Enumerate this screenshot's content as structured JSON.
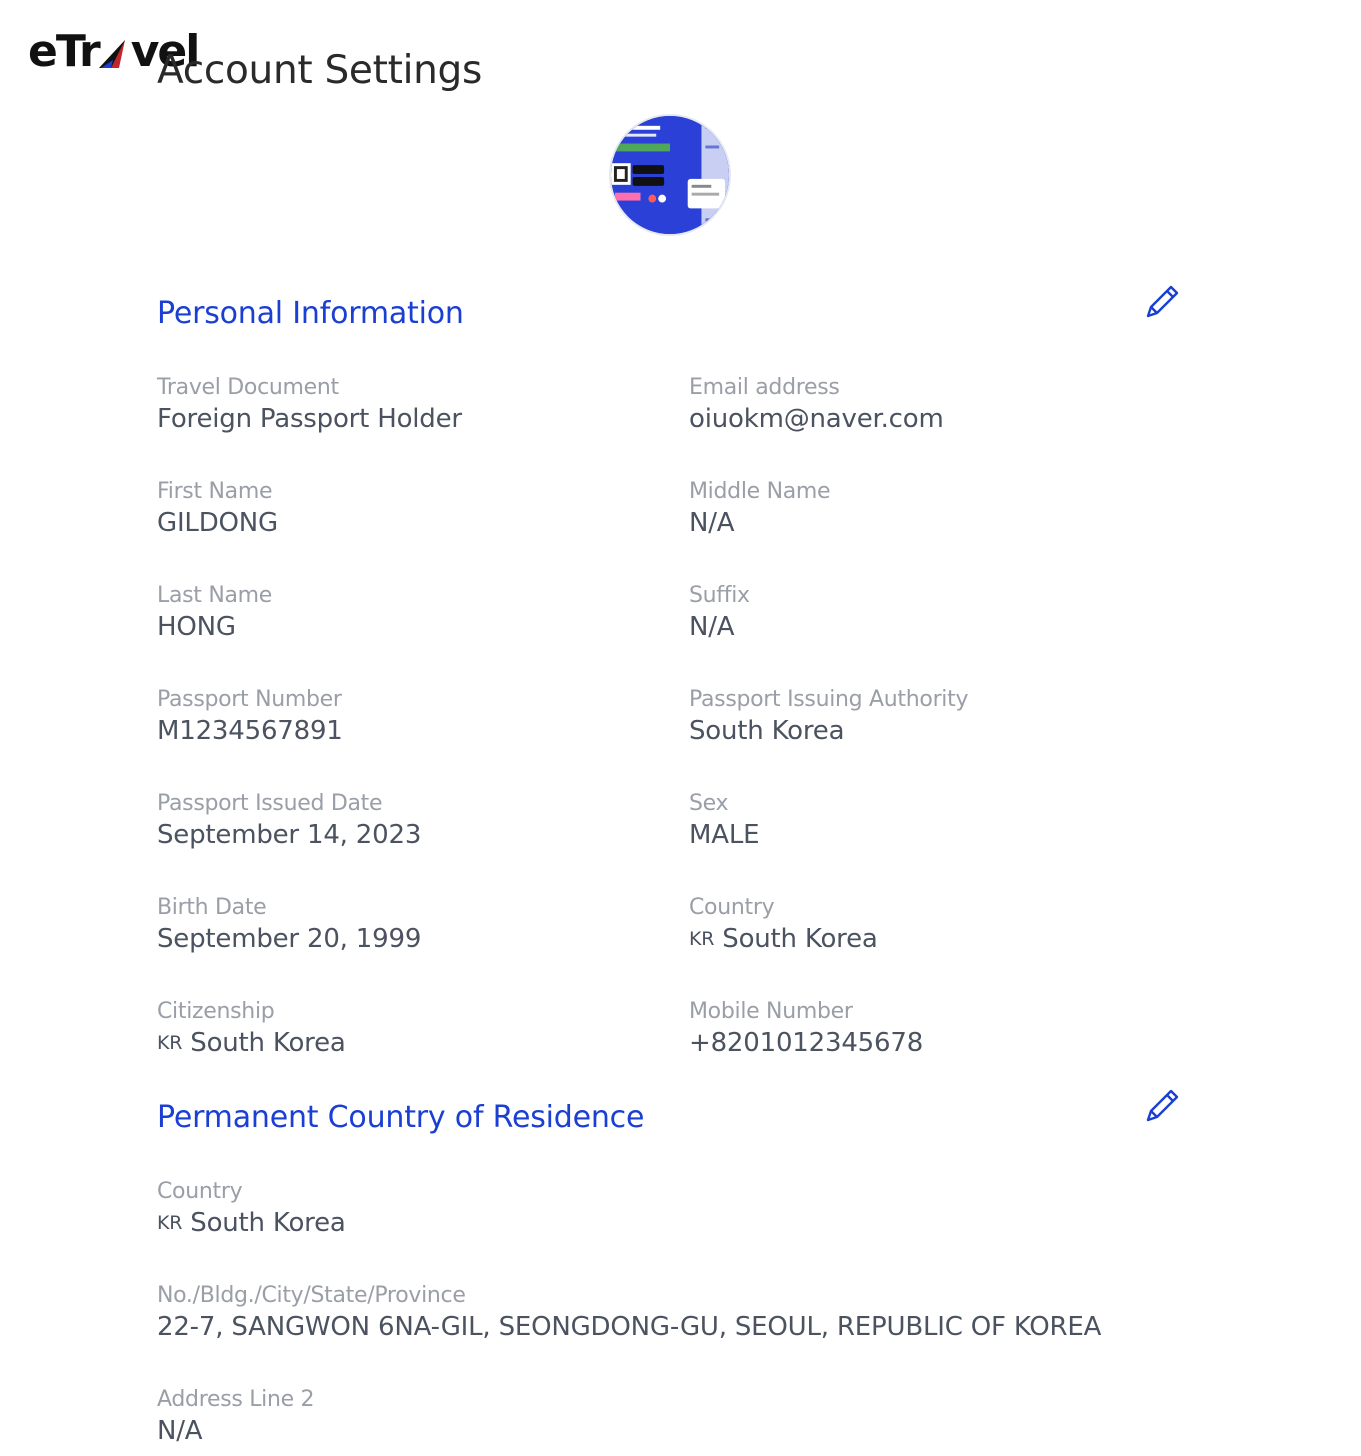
{
  "header": {
    "logo_text_left": "eTr",
    "logo_text_right": "vel",
    "page_title": "Account Settings"
  },
  "personal": {
    "title": "Personal Information",
    "fields": {
      "travel_document": {
        "label": "Travel Document",
        "value": "Foreign Passport Holder"
      },
      "email": {
        "label": "Email address",
        "value": "oiuokm@naver.com"
      },
      "first_name": {
        "label": "First Name",
        "value": "GILDONG"
      },
      "middle_name": {
        "label": "Middle Name",
        "value": "N/A"
      },
      "last_name": {
        "label": "Last Name",
        "value": "HONG"
      },
      "suffix": {
        "label": "Suffix",
        "value": "N/A"
      },
      "passport_number": {
        "label": "Passport Number",
        "value": "M1234567891"
      },
      "passport_authority": {
        "label": "Passport Issuing Authority",
        "value": "South Korea"
      },
      "passport_issued": {
        "label": "Passport Issued Date",
        "value": "September 14, 2023"
      },
      "sex": {
        "label": "Sex",
        "value": "MALE"
      },
      "birth_date": {
        "label": "Birth Date",
        "value": "September 20, 1999"
      },
      "country": {
        "label": "Country",
        "code": "KR",
        "value": "South Korea"
      },
      "citizenship": {
        "label": "Citizenship",
        "code": "KR",
        "value": "South Korea"
      },
      "mobile": {
        "label": "Mobile Number",
        "value": "+8201012345678"
      }
    }
  },
  "residence": {
    "title": "Permanent Country of Residence",
    "fields": {
      "country": {
        "label": "Country",
        "code": "KR",
        "value": "South Korea"
      },
      "address1": {
        "label": "No./Bldg./City/State/Province",
        "value": "22-7, SANGWON 6NA-GIL, SEONGDONG-GU, SEOUL, REPUBLIC OF KOREA"
      },
      "address2": {
        "label": "Address Line 2",
        "value": "N/A"
      }
    }
  },
  "colors": {
    "accent": "#1a3fd2",
    "label": "#9a9ea6",
    "value": "#4b5260",
    "title": "#2a2a2a"
  },
  "icons": {
    "edit": "pencil-icon",
    "logo_mark": "paper-plane-icon"
  }
}
